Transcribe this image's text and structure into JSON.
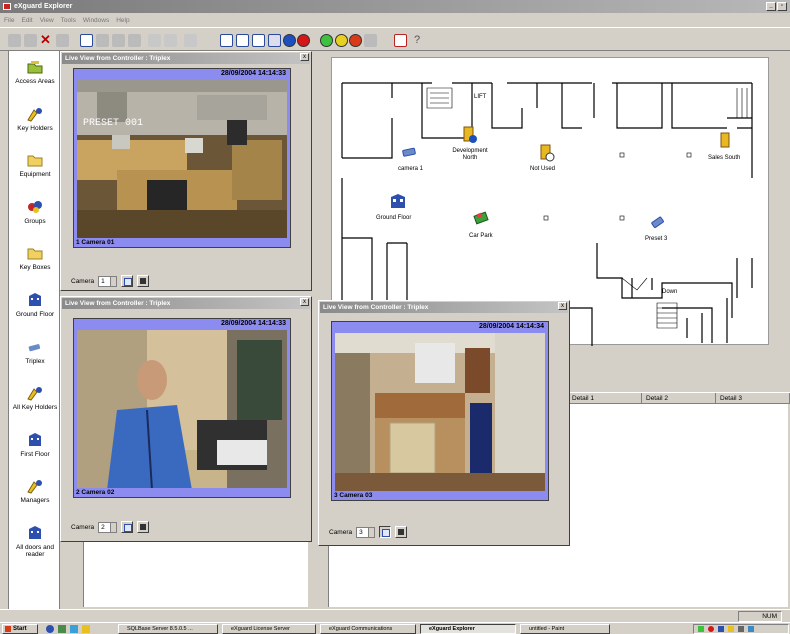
{
  "window": {
    "title": "eXguard Explorer"
  },
  "menu": [
    "File",
    "Edit",
    "View",
    "Tools",
    "Windows",
    "Help"
  ],
  "sidebar": {
    "items": [
      {
        "label": "Access Areas",
        "icon": "folder-key-icon"
      },
      {
        "label": "Key Holders",
        "icon": "key-holders-icon"
      },
      {
        "label": "Equipment",
        "icon": "folder-icon"
      },
      {
        "label": "Groups",
        "icon": "groups-icon"
      },
      {
        "label": "Key Boxes",
        "icon": "folder-icon"
      },
      {
        "label": "Ground Floor",
        "icon": "building-icon"
      },
      {
        "label": "Triplex",
        "icon": "camera-icon"
      },
      {
        "label": "All Key Holders",
        "icon": "key-holders-icon"
      },
      {
        "label": "First Floor",
        "icon": "building-icon"
      },
      {
        "label": "Managers",
        "icon": "key-holders-icon"
      },
      {
        "label": "All doors and reader",
        "icon": "building-icon"
      }
    ]
  },
  "live_views": [
    {
      "title": "Live View from Controller : Triplex",
      "timestamp": "28/09/2004 14:14:33",
      "camera_caption": "1 Camera 01",
      "camera_label": "Camera",
      "camera_number": "1",
      "overlay": "PRESET 001"
    },
    {
      "title": "Live View from Controller : Triplex",
      "timestamp": "28/09/2004 14:14:33",
      "camera_caption": "2 Camera 02",
      "camera_label": "Camera",
      "camera_number": "2"
    },
    {
      "title": "Live View from Controller : Triplex",
      "timestamp": "28/09/2004 14:14:34",
      "camera_caption": "3 Camera 03",
      "camera_label": "Camera",
      "camera_number": "3"
    }
  ],
  "map": {
    "labels": {
      "lift": "LIFT",
      "camera1": "camera 1",
      "dev_north": "Development North",
      "not_used": "Not Used",
      "sales_south": "Sales South",
      "ground_floor": "Ground Floor",
      "car_park": "Car Park",
      "preset3": "Preset 3",
      "down": "Down"
    }
  },
  "detail_columns": [
    "Detail 1",
    "Detail 2",
    "Detail 3"
  ],
  "status": {
    "num": "NUM"
  },
  "taskbar": {
    "start": "Start",
    "tasks": [
      {
        "label": "SQLBase Server 8.5.0.5 ..."
      },
      {
        "label": "eXguard License Server"
      },
      {
        "label": "eXguard Communications"
      },
      {
        "label": "eXguard Explorer",
        "active": true
      },
      {
        "label": "untitled - Paint"
      }
    ]
  },
  "colors": {
    "frame_purple": "#8c8cf0",
    "taskbar": "#d4d0c8"
  }
}
